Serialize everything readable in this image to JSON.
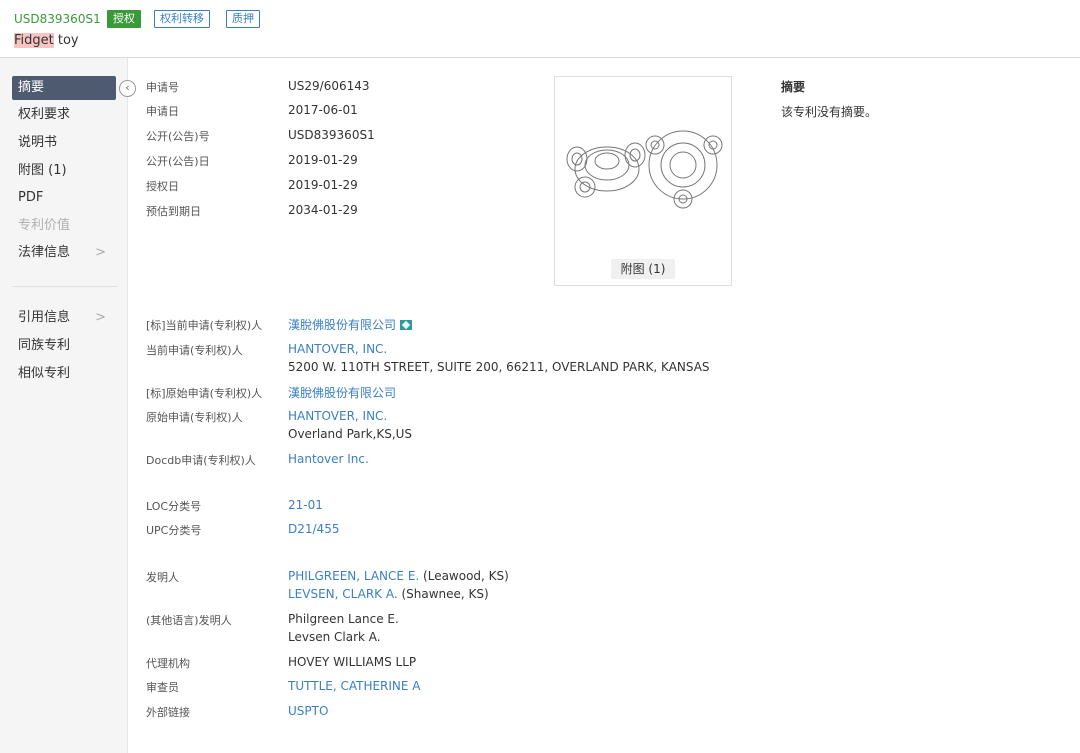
{
  "header": {
    "pub_number": "USD839360S1",
    "badges": [
      "授权",
      "权利转移",
      "质押"
    ],
    "title_highlight": "Fidget",
    "title_rest": " toy"
  },
  "sidebar": {
    "items": [
      {
        "label": "摘要",
        "active": true
      },
      {
        "label": "权利要求"
      },
      {
        "label": "说明书"
      },
      {
        "label": "附图 (1)"
      },
      {
        "label": "PDF"
      },
      {
        "label": "专利价值",
        "disabled": true
      },
      {
        "label": "法律信息",
        "chevron": ">"
      },
      {
        "label": "引用信息",
        "chevron": ">"
      },
      {
        "label": "同族专利"
      },
      {
        "label": "相似专利"
      }
    ],
    "collapse_icon": "‹"
  },
  "fields_top": [
    {
      "label": "申请号",
      "value": "US29/606143"
    },
    {
      "label": "申请日",
      "value": "2017-06-01"
    },
    {
      "label": "公开(公告)号",
      "value": "USD839360S1"
    },
    {
      "label": "公开(公告)日",
      "value": "2019-01-29"
    },
    {
      "label": "授权日",
      "value": "2019-01-29"
    },
    {
      "label": "预估到期日",
      "value": "2034-01-29"
    }
  ],
  "figure": {
    "button": "附图 (1)"
  },
  "abstract": {
    "title": "摘要",
    "text": "该专利没有摘要。"
  },
  "parties": {
    "std_current_label": "[标]当前申请(专利权)人",
    "std_current_value": "漢脫佛股份有限公司",
    "current_label": "当前申请(专利权)人",
    "current_value": "HANTOVER, INC.",
    "current_address": "5200 W. 110TH STREET, SUITE 200, 66211, OVERLAND PARK, KANSAS",
    "std_original_label": "[标]原始申请(专利权)人",
    "std_original_value": "漢脫佛股份有限公司",
    "original_label": "原始申请(专利权)人",
    "original_value": "HANTOVER, INC.",
    "original_address": "Overland Park,KS,US",
    "docdb_label": "Docdb申请(专利权)人",
    "docdb_value": "Hantover Inc."
  },
  "classes": {
    "loc_label": "LOC分类号",
    "loc_value": "21-01",
    "upc_label": "UPC分类号",
    "upc_value": "D21/455"
  },
  "people": {
    "inventor_label": "发明人",
    "inventor1_name": "PHILGREEN, LANCE E.",
    "inventor1_loc": " (Leawood, KS)",
    "inventor2_name": "LEVSEN, CLARK A.",
    "inventor2_loc": " (Shawnee, KS)",
    "other_lang_label": "(其他语言)发明人",
    "other1": "Philgreen Lance E.",
    "other2": "Levsen Clark A.",
    "agency_label": "代理机构",
    "agency_value": "HOVEY WILLIAMS LLP",
    "examiner_label": "审查员",
    "examiner_value": "TUTTLE, CATHERINE A",
    "external_label": "外部链接",
    "external_value": "USPTO"
  }
}
